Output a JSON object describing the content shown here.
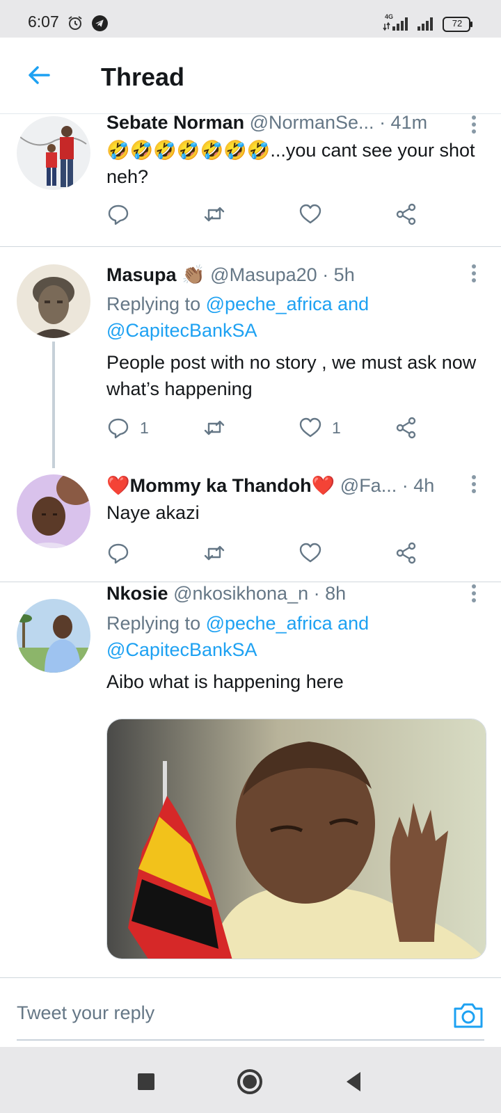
{
  "status_bar": {
    "time": "6:07",
    "network": "4G",
    "battery": "72"
  },
  "header": {
    "title": "Thread"
  },
  "tweets": [
    {
      "name": "Sebate Norman",
      "handle": "@NormanSe...",
      "time": "· 41m",
      "body": "🤣🤣🤣🤣🤣🤣🤣...you cant see your shot neh?",
      "replies": "",
      "likes": ""
    },
    {
      "name": "Masupa 👏🏽",
      "handle": "@Masupa20",
      "time": "· 5h",
      "replying_prefix": "Replying to ",
      "replying_mention_1": "@peche_africa",
      "replying_and": " and",
      "replying_mention_2": "@CapitecBankSA",
      "body": "People post with no story , we must ask now what’s happening",
      "replies": "1",
      "likes": "1"
    },
    {
      "name": "❤️Mommy ka Thandoh❤️",
      "handle": "@Fa...",
      "time": "· 4h",
      "body": "Naye akazi",
      "replies": "",
      "likes": ""
    },
    {
      "name": "Nkosie",
      "handle": "@nkosikhona_n",
      "time": "· 8h",
      "replying_prefix": "Replying to ",
      "replying_mention_1": "@peche_africa",
      "replying_and": " and",
      "replying_mention_2": "@CapitecBankSA",
      "body": "Aibo what is happening here",
      "replies": "",
      "likes": ""
    }
  ],
  "reply_bar": {
    "placeholder": "Tweet your reply"
  },
  "colors": {
    "accent": "#1da1f2",
    "secondary_text": "#657786",
    "divider": "#d0d7dd"
  },
  "icons": [
    "alarm-icon",
    "telegram-icon",
    "signal-icon",
    "battery-icon",
    "back-arrow-icon",
    "more-vertical-icon",
    "reply-icon",
    "retweet-icon",
    "like-icon",
    "share-icon",
    "camera-icon",
    "recents-icon",
    "home-icon",
    "back-icon"
  ]
}
